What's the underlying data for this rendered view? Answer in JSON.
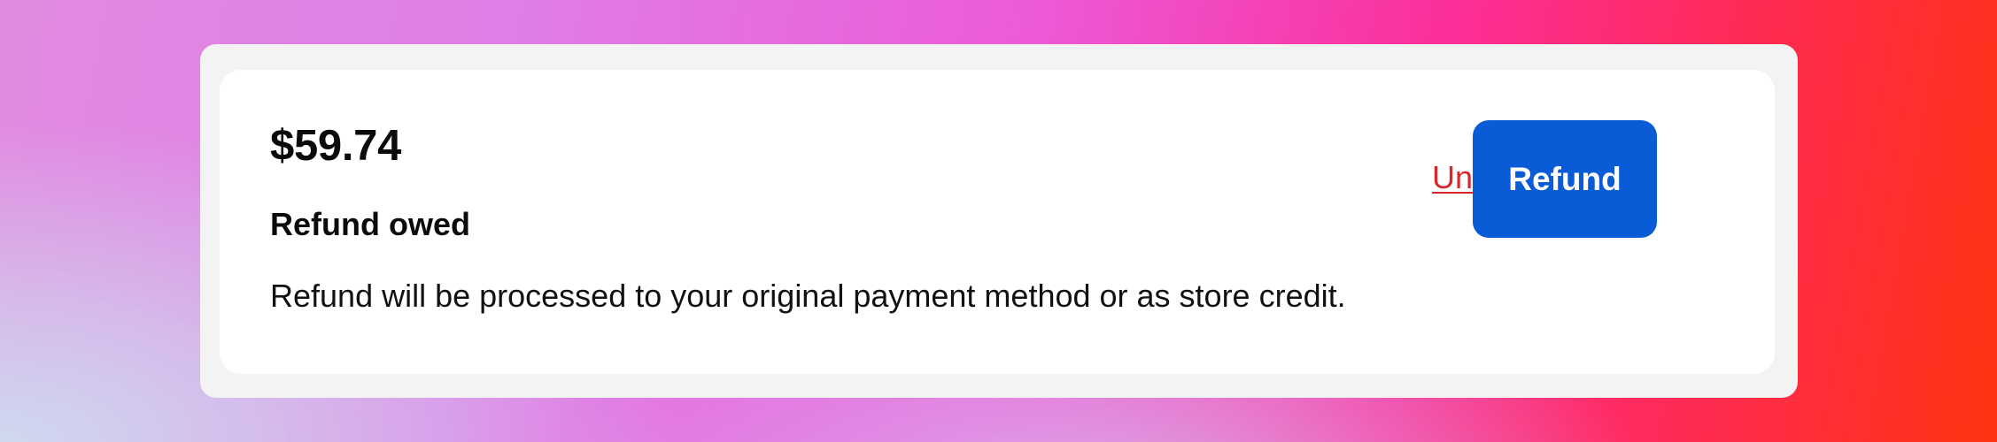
{
  "refund": {
    "amount": "$59.74",
    "status_label": "Refund owed",
    "description": "Refund will be processed to your original payment method or as store credit.",
    "undo_label": "Undo",
    "button_label": "Refund"
  },
  "colors": {
    "button_background": "#0a5bd6",
    "button_text": "#ffffff",
    "undo_link": "#d8272a",
    "card_inner": "#ffffff",
    "card_outer": "#f3f3f3"
  }
}
